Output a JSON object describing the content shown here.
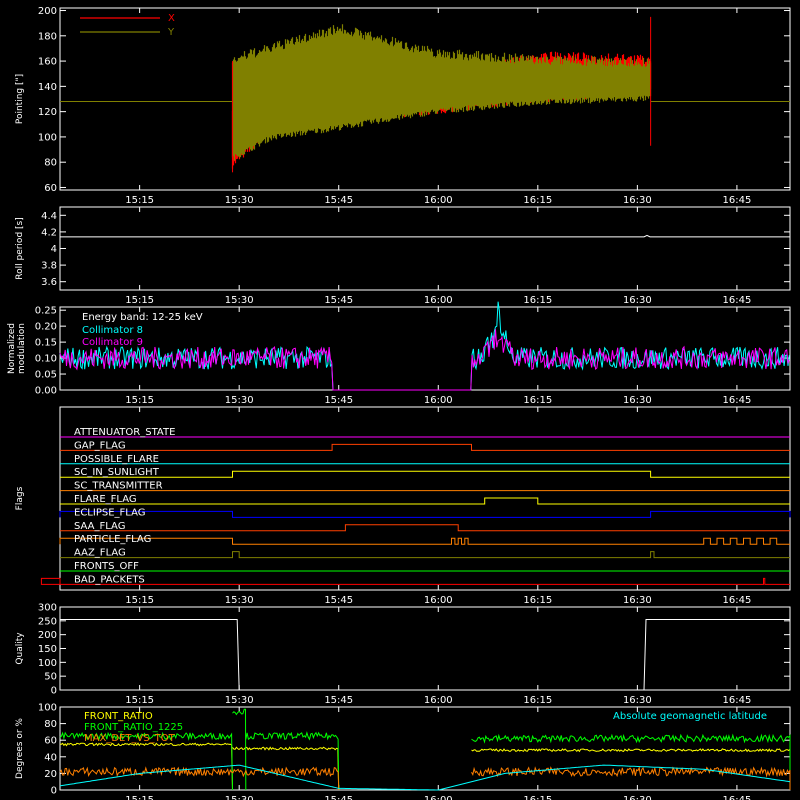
{
  "chart_data": [
    {
      "type": "line",
      "ylabel": "Pointing [\"]",
      "ylim": [
        58,
        202
      ],
      "yticks": [
        60,
        80,
        100,
        120,
        140,
        160,
        180,
        200
      ],
      "x_ticks": [
        "15:15",
        "15:30",
        "15:45",
        "16:00",
        "16:15",
        "16:30",
        "16:45"
      ],
      "legend": [
        {
          "name": "X",
          "color": "#ff0000"
        },
        {
          "name": "Y",
          "color": "#808000"
        }
      ],
      "series": [
        {
          "name": "X",
          "color": "#ff0000",
          "baseline": 128,
          "t_on": "15:29",
          "t_off": "16:32",
          "envelope_min": [
            [
              15.48,
              74
            ],
            [
              15.58,
              103
            ],
            [
              15.75,
              110
            ],
            [
              16.0,
              118
            ],
            [
              16.25,
              127
            ],
            [
              16.53,
              133
            ]
          ],
          "envelope_max": [
            [
              15.48,
              128
            ],
            [
              15.75,
              128
            ],
            [
              16.25,
              168
            ],
            [
              16.53,
              165
            ]
          ]
        },
        {
          "name": "Y",
          "color": "#808000",
          "baseline": 128,
          "t_on": "15:29",
          "t_off": "16:32",
          "envelope_min": [
            [
              15.48,
              80
            ],
            [
              15.58,
              97
            ],
            [
              15.75,
              105
            ],
            [
              16.0,
              118
            ],
            [
              16.25,
              125
            ],
            [
              16.53,
              128
            ]
          ],
          "envelope_max": [
            [
              15.48,
              165
            ],
            [
              15.75,
              190
            ],
            [
              16.0,
              170
            ],
            [
              16.25,
              165
            ],
            [
              16.53,
              163
            ]
          ]
        }
      ]
    },
    {
      "type": "line",
      "ylabel": "Roll period [s]",
      "ylim": [
        3.5,
        4.5
      ],
      "yticks": [
        3.6,
        3.8,
        4.0,
        4.2,
        4.4
      ],
      "x_ticks": [
        "15:15",
        "15:30",
        "15:45",
        "16:00",
        "16:15",
        "16:30",
        "16:45"
      ],
      "series": [
        {
          "name": "roll",
          "color": "#ffffff",
          "value": 4.14
        }
      ]
    },
    {
      "type": "line",
      "ylabel": "Normalized modulation",
      "ylim": [
        0,
        0.26
      ],
      "yticks": [
        0.0,
        0.05,
        0.1,
        0.15,
        0.2,
        0.25
      ],
      "x_ticks": [
        "15:15",
        "15:30",
        "15:45",
        "16:00",
        "16:15",
        "16:30",
        "16:45"
      ],
      "annotation": "Energy band: 12-25 keV",
      "series": [
        {
          "name": "Collimator 8",
          "color": "#00ffff",
          "mean": 0.1,
          "gap": [
            "15:44",
            "16:05"
          ],
          "peak": {
            "t": "16:09",
            "v": 0.24
          }
        },
        {
          "name": "Collimator 9",
          "color": "#ff00ff",
          "mean": 0.1,
          "gap": [
            "15:44",
            "16:05"
          ],
          "peak": {
            "t": "16:09",
            "v": 0.17
          }
        }
      ]
    },
    {
      "type": "line",
      "ylabel": "Flags",
      "x_ticks": [
        "15:15",
        "15:30",
        "15:45",
        "16:00",
        "16:15",
        "16:30",
        "16:45"
      ],
      "flags": [
        {
          "name": "ATTENUATOR_STATE",
          "color": "#ff00ff",
          "on": []
        },
        {
          "name": "GAP_FLAG",
          "color": "#ff4000",
          "on": [
            [
              "15:44",
              "16:05"
            ]
          ]
        },
        {
          "name": "POSSIBLE_FLARE",
          "color": "#00ffff",
          "on": []
        },
        {
          "name": "SC_IN_SUNLIGHT",
          "color": "#ffff00",
          "on": [
            [
              "15:29",
              "16:32"
            ]
          ]
        },
        {
          "name": "SC_TRANSMITTER",
          "color": "#ff8000",
          "on": []
        },
        {
          "name": "FLARE_FLAG",
          "color": "#ffff00",
          "on": [
            [
              "16:07",
              "16:15"
            ]
          ]
        },
        {
          "name": "ECLIPSE_FLAG",
          "color": "#0000ff",
          "on": [
            [
              "15:00",
              "15:29"
            ],
            [
              "16:32",
              "16:53"
            ]
          ]
        },
        {
          "name": "SAA_FLAG",
          "color": "#ff4000",
          "on": [
            [
              "15:46",
              "16:03"
            ]
          ]
        },
        {
          "name": "PARTICLE_FLAG",
          "color": "#ff8000",
          "on": [
            [
              "15:00",
              "15:29"
            ],
            [
              "16:02",
              "16:02.5"
            ],
            [
              "16:03",
              "16:03.5"
            ],
            [
              "16:04",
              "16:04.5"
            ],
            [
              "16:40",
              "16:41"
            ],
            [
              "16:42",
              "16:43"
            ],
            [
              "16:44",
              "16:45"
            ],
            [
              "16:46",
              "16:47"
            ],
            [
              "16:48",
              "16:49"
            ],
            [
              "16:50",
              "16:51"
            ]
          ]
        },
        {
          "name": "AAZ_FLAG",
          "color": "#808000",
          "on": [
            [
              "15:29",
              "15:30"
            ],
            [
              "16:32",
              "16:32.5"
            ]
          ]
        },
        {
          "name": "FRONTS_OFF",
          "color": "#00ff00",
          "on": []
        },
        {
          "name": "BAD_PACKETS",
          "color": "#ff0000",
          "on": [
            [
              "15:00",
              "15:00.2"
            ],
            [
              "16:49",
              "16:49.2"
            ]
          ]
        }
      ]
    },
    {
      "type": "line",
      "ylabel": "Quality",
      "ylim": [
        0,
        300
      ],
      "yticks": [
        0,
        50,
        100,
        150,
        200,
        250,
        300
      ],
      "x_ticks": [
        "15:15",
        "15:30",
        "15:45",
        "16:00",
        "16:15",
        "16:30",
        "16:45"
      ],
      "series": [
        {
          "name": "quality",
          "color": "#ffffff",
          "high": 255,
          "low": 0,
          "low_range": [
            "15:30",
            "16:31"
          ]
        }
      ]
    },
    {
      "type": "line",
      "ylabel": "Degrees or %",
      "ylim": [
        0,
        100
      ],
      "yticks": [
        0,
        20,
        40,
        60,
        80,
        100
      ],
      "x_ticks": [
        "15:15",
        "15:30",
        "15:45",
        "16:00",
        "16:15",
        "16:30",
        "16:45"
      ],
      "legend": [
        {
          "name": "FRONT_RATIO",
          "color": "#ffff00"
        },
        {
          "name": "FRONT_RATIO_1225",
          "color": "#00ff00"
        },
        {
          "name": "MAX_DET_VS_TOT",
          "color": "#ff8000"
        },
        {
          "name": "Absolute geomagnetic latitude",
          "color": "#00ffff"
        }
      ],
      "series": [
        {
          "name": "FRONT_RATIO",
          "color": "#ffff00",
          "segments": [
            {
              "t": [
                "15:03",
                "15:29"
              ],
              "v": 55
            },
            {
              "t": [
                "15:29",
                "15:45"
              ],
              "v": 50
            },
            {
              "t": [
                "16:05",
                "16:53"
              ],
              "v": 48
            }
          ]
        },
        {
          "name": "FRONT_RATIO_1225",
          "color": "#00ff00",
          "segments": [
            {
              "t": [
                "15:03",
                "15:29"
              ],
              "v": 65
            },
            {
              "t": [
                "15:29",
                "15:31"
              ],
              "v": 95
            },
            {
              "t": [
                "15:31",
                "15:45"
              ],
              "v": 65
            },
            {
              "t": [
                "16:05",
                "16:53"
              ],
              "v": 62
            }
          ]
        },
        {
          "name": "MAX_DET_VS_TOT",
          "color": "#ff8000",
          "segments": [
            {
              "t": [
                "15:03",
                "15:45"
              ],
              "v": 22
            },
            {
              "t": [
                "16:05",
                "16:53"
              ],
              "v": 22
            }
          ]
        },
        {
          "name": "Absolute geomagnetic latitude",
          "color": "#00ffff",
          "points": [
            [
              "15:03",
              5
            ],
            [
              "15:15",
              20
            ],
            [
              "15:30",
              30
            ],
            [
              "15:45",
              2
            ],
            [
              "16:00",
              0
            ],
            [
              "16:10",
              20
            ],
            [
              "16:25",
              30
            ],
            [
              "16:40",
              25
            ],
            [
              "16:53",
              10
            ]
          ]
        }
      ]
    }
  ]
}
